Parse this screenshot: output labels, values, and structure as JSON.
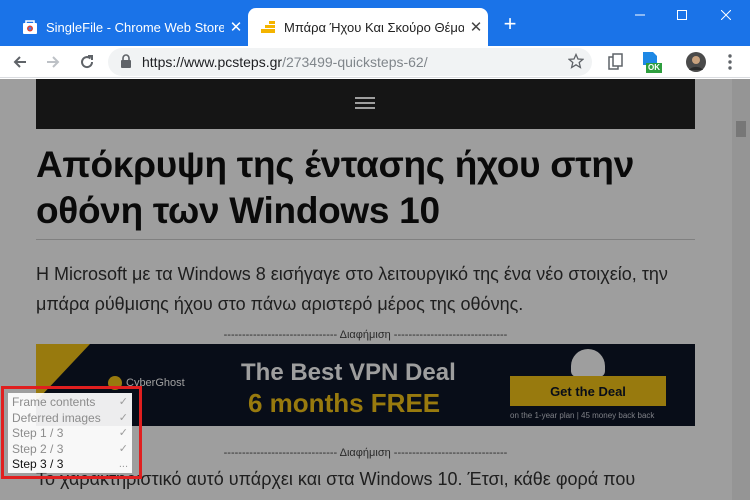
{
  "browser": {
    "tabs": [
      {
        "title": "SingleFile - Chrome Web Store",
        "active": false
      },
      {
        "title": "Μπάρα Ήχου Και Σκούρο Θέμα",
        "active": true
      }
    ],
    "new_tab_label": "+",
    "url_host": "https://www.pcsteps.gr",
    "url_path": "/273499-quicksteps-62/",
    "extension_badge": "OK"
  },
  "article": {
    "title": "Απόκρυψη της έντασης ήχου στην οθόνη των Windows 10",
    "intro": "Η Microsoft με τα Windows 8 εισήγαγε στο λειτουργικό της ένα νέο στοιχείο, την μπάρα ρύθμισης ήχου στο πάνω αριστερό μέρος της οθόνης.",
    "ad_label": "------------------------------- Διαφήμιση -------------------------------",
    "body": "Το χαρακτηριστικό αυτό υπάρχει και στα Windows 10. Έτσι, κάθε φορά που"
  },
  "ad": {
    "brand": "CyberGhost",
    "headline": "The Best VPN Deal",
    "subheadline": "6 months FREE",
    "cta": "Get the Deal",
    "fine_print": "on the 1-year plan | 45 money back back"
  },
  "singlefile_panel": {
    "steps": [
      {
        "label": "Frame contents",
        "mark": "✓"
      },
      {
        "label": "Deferred images",
        "mark": "✓"
      },
      {
        "label": "Step 1 / 3",
        "mark": "✓"
      },
      {
        "label": "Step 2 / 3",
        "mark": "✓"
      },
      {
        "label": "Step 3 / 3",
        "mark": "..."
      }
    ]
  },
  "colors": {
    "chrome_blue": "#1a73e8",
    "highlight": "#e01f1f",
    "ad_yellow": "#f5c518"
  }
}
